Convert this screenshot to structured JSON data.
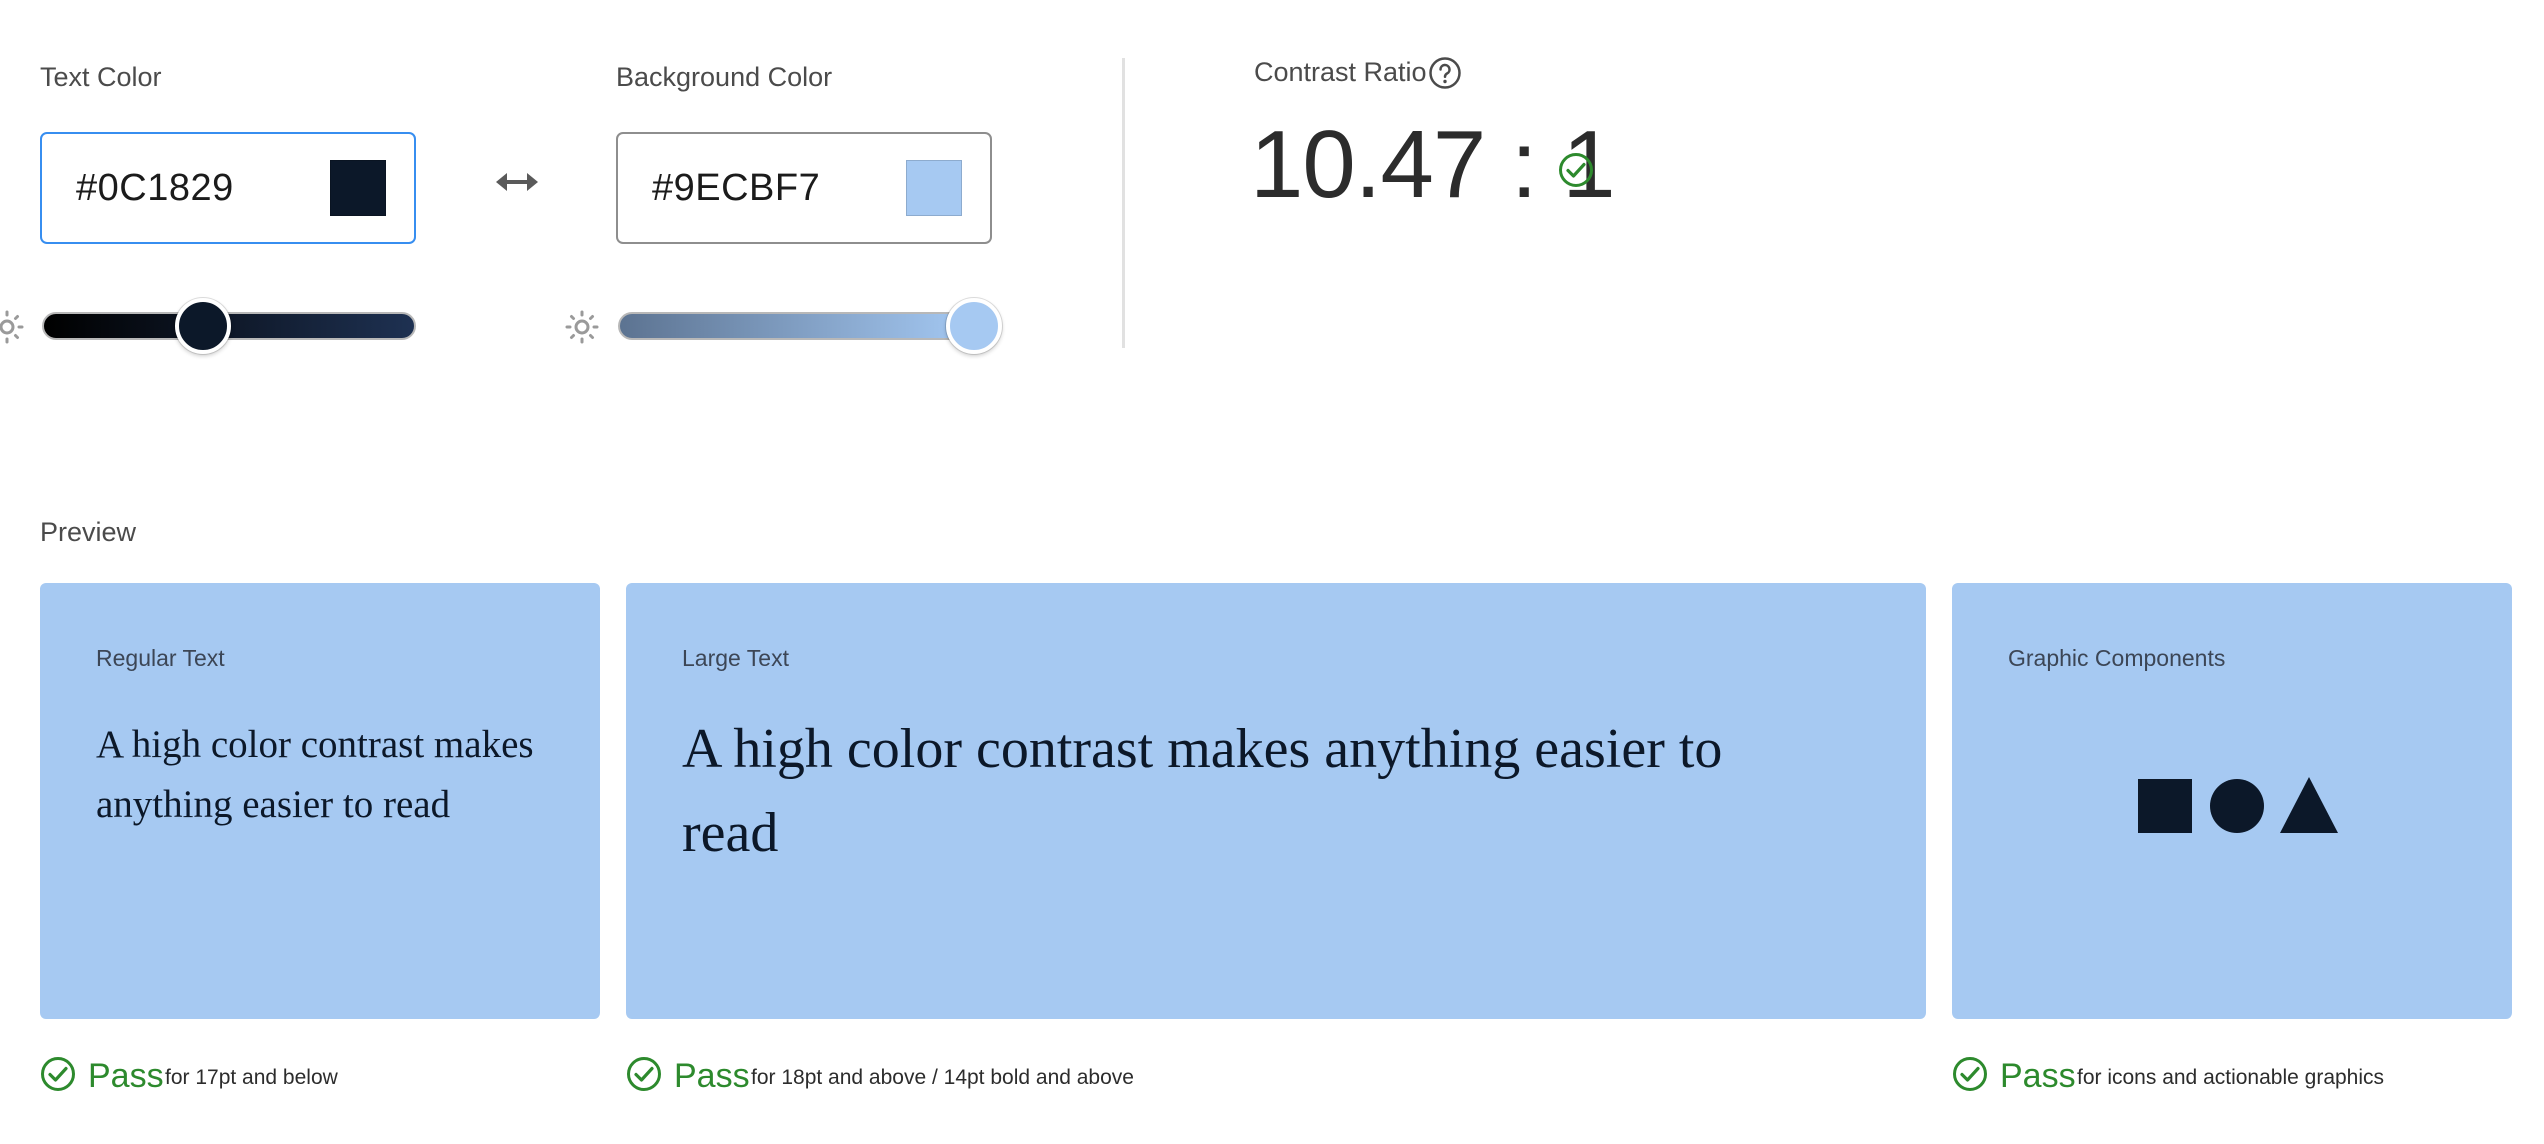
{
  "text_color": {
    "label": "Text Color",
    "hex": "#0C1829",
    "swatch": "#0C1829",
    "slider_value": 0.44
  },
  "swap_icon": "swap-horizontal-icon",
  "background_color": {
    "label": "Background Color",
    "hex": "#9ECBF7",
    "swatch": "#A6C9F2",
    "slider_value": 1.0
  },
  "contrast": {
    "label": "Contrast Ratio",
    "value": "10.47 : 1",
    "help_icon": "question-circle-icon",
    "status_icon": "check-circle-icon"
  },
  "preview": {
    "label": "Preview",
    "card_color": "#A6C9F2",
    "text_color": "#0C1829",
    "cards": [
      {
        "title": "Regular Text",
        "sample": "A high color contrast makes anything easier to read",
        "result": "Pass",
        "note": "for 17pt and below"
      },
      {
        "title": "Large Text",
        "sample": "A high color contrast makes anything easier to read",
        "result": "Pass",
        "note": "for 18pt and above / 14pt bold and above"
      },
      {
        "title": "Graphic Components",
        "shapes": [
          "square-shape",
          "circle-shape",
          "triangle-shape"
        ],
        "result": "Pass",
        "note": "for icons and actionable graphics"
      }
    ]
  },
  "colors": {
    "pass_green": "#2D8A2D",
    "focus_blue": "#378EF0"
  }
}
